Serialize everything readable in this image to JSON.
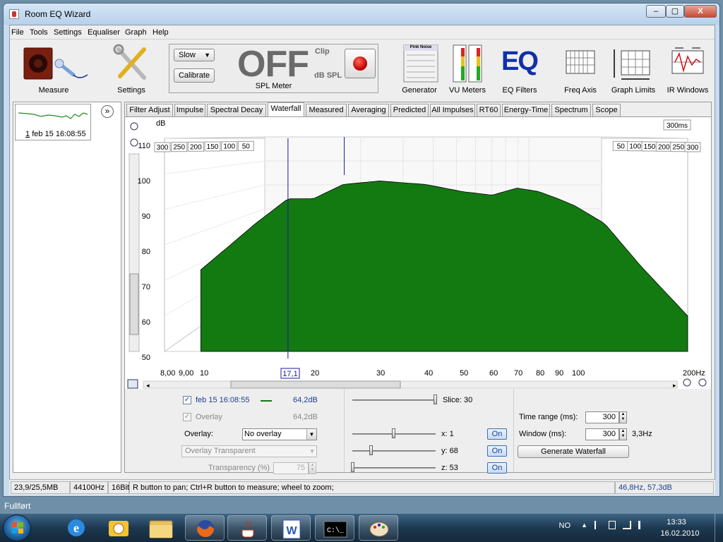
{
  "window": {
    "title": "Room EQ Wizard",
    "min": "–",
    "max": "▢",
    "close": "X"
  },
  "menu": [
    "File",
    "Tools",
    "Settings",
    "Equaliser",
    "Graph",
    "Help"
  ],
  "toolbar": {
    "measure": "Measure",
    "settings": "Settings",
    "speed_select": "Slow",
    "calibrate": "Calibrate",
    "spl_value": "OFF",
    "clip": "Clip",
    "db_spl": "dB SPL",
    "spl_meter": "SPL Meter",
    "generator": "Generator",
    "generator_panel": "Pink Noise",
    "vu_meters": "VU Meters",
    "eq_filters": "EQ Filters",
    "eq_logo": "EQ",
    "freq_axis": "Freq Axis",
    "graph_limits": "Graph Limits",
    "ir_windows": "IR Windows"
  },
  "measurement": {
    "index": "1",
    "name": "feb 15 16:08:55"
  },
  "tabs": [
    "Filter Adjust",
    "Impulse",
    "Spectral Decay",
    "Waterfall",
    "Measured",
    "Averaging",
    "Predicted",
    "All Impulses",
    "RT60",
    "Energy-Time",
    "Spectrum",
    "Scope"
  ],
  "active_tab": "Waterfall",
  "graph": {
    "y_unit": "dB",
    "y_ticks": [
      "110",
      "100",
      "90",
      "80",
      "70",
      "60",
      "50"
    ],
    "x_ticks": [
      "8,00",
      "9,00",
      "10",
      "20",
      "30",
      "40",
      "50",
      "60",
      "70",
      "80",
      "90",
      "100",
      "200Hz"
    ],
    "cursor_freq": "17,1",
    "time_unit": "300ms",
    "time_ticks_left": [
      "50",
      "100",
      "150",
      "200",
      "250",
      "300"
    ],
    "time_ticks_right": [
      "50",
      "100",
      "150",
      "200",
      "250",
      "300"
    ],
    "fill_color": "#137a12",
    "cursor_color": "#1a1aa8"
  },
  "chart_data": {
    "type": "area",
    "title": "",
    "xlabel": "Hz",
    "ylabel": "dB",
    "x_scale": "log",
    "xlim": [
      8,
      200
    ],
    "ylim": [
      50,
      110
    ],
    "zlabel": "ms",
    "zlim": [
      0,
      300
    ],
    "slices": 30,
    "series": [
      {
        "name": "feb 15 16:08:55",
        "time_ms": 0,
        "x": [
          10,
          12,
          14,
          17.1,
          20,
          24,
          30,
          40,
          50,
          60,
          70,
          80,
          90,
          100,
          120,
          150,
          200
        ],
        "values": [
          73,
          80,
          86,
          93,
          93,
          97,
          98,
          97,
          95,
          94,
          96,
          95,
          93,
          91,
          86,
          74,
          60
        ]
      }
    ]
  },
  "controls": {
    "legend_name": "feb 15 16:08:55",
    "legend_value": "64,2dB",
    "overlay_label": "Overlay",
    "overlay_value": "64,2dB",
    "overlay_field_label": "Overlay:",
    "overlay_select": "No overlay",
    "overlay_transparent": "Overlay Transparent",
    "transparency_label": "Transparency (%)",
    "transparency_value": "75",
    "slice_label": "Slice: 30",
    "x_label": "x: 1",
    "y_label": "y: 68",
    "z_label": "z: 53",
    "on": "On",
    "time_range_label": "Time range (ms):",
    "time_range_value": "300",
    "window_label": "Window (ms):",
    "window_value": "300",
    "window_hz": "3,3Hz",
    "generate": "Generate Waterfall"
  },
  "status": {
    "memory": "23,9/25,5MB",
    "rate": "44100Hz",
    "bits": "16Bit",
    "hint": "R button to pan; Ctrl+R button to measure; wheel to zoom;",
    "readout": "46,8Hz,  57,3dB"
  },
  "below_window_text": "Fullført",
  "tray": {
    "lang": "NO",
    "time": "13:33",
    "date": "16.02.2010"
  }
}
